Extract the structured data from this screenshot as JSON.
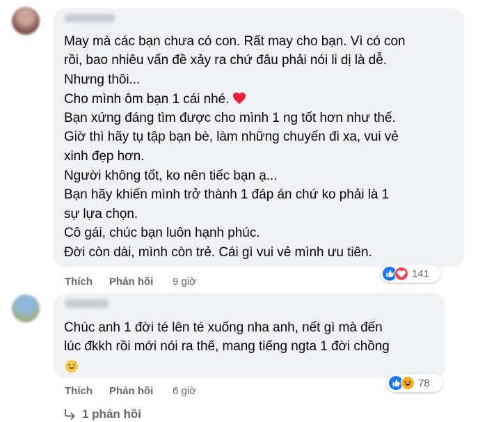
{
  "comments": [
    {
      "lines": [
        "May mà các bạn chưa có con. Rất may cho bạn. Vì có con",
        "rồi, bao nhiêu vấn đề xảy ra chứ đâu phải nói li dị là dễ.",
        "Nhưng thôi...",
        "Cho mình ôm bạn 1 cái nhé.",
        "Bạn xứng đáng tìm được cho mình 1 ng tốt hơn như thế.",
        "Giờ thì hãy tụ tập bạn bè, làm những chuyến đi xa, vui vẻ",
        "xinh đẹp hơn.",
        "Người không tốt, ko nên tiếc bạn ạ...",
        "Bạn hãy khiến mình trở thành 1 đáp án chứ ko phải là 1",
        "sự lựa chọn.",
        "Cô gái, chúc bạn luôn hạnh phúc.",
        "Đời còn dài, mình còn trẻ. Cái gì vui vẻ mình ưu tiên."
      ],
      "like_label": "Thích",
      "reply_label": "Phản hồi",
      "time": "9 giờ",
      "reaction_count": "141",
      "reaction_icons": [
        "like-icon",
        "love-icon"
      ]
    },
    {
      "lines": [
        "Chúc anh 1 đời té lên té xuống nha anh, nết gì mà đến",
        "lúc đkkh rồi mới nói ra thế, mang tiếng ngta 1 đời chồng"
      ],
      "like_label": "Thích",
      "reply_label": "Phản hồi",
      "time": "6 giờ",
      "reaction_count": "78",
      "reaction_icons": [
        "like-icon",
        "haha-icon"
      ]
    }
  ],
  "replies_label": "1 phản hồi",
  "colors": {
    "bubble": "#f0f2f5",
    "text": "#050505",
    "secondary": "#65676b",
    "like_blue": "#1877f2",
    "love_red": "#f33e58",
    "haha_yellow": "#f7b125"
  }
}
